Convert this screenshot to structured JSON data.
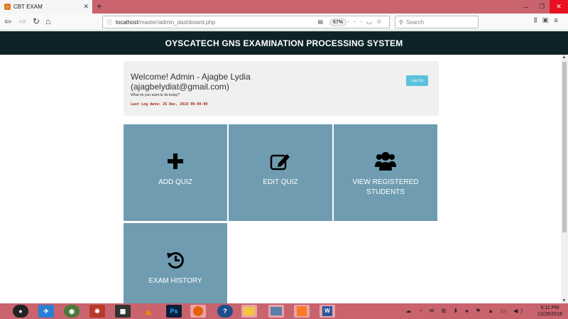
{
  "browser": {
    "tab_title": "CBT EXAM",
    "url_host": "localhost",
    "url_path": "/master/admin_dashboard.php",
    "zoom": "67%",
    "search_placeholder": "Search"
  },
  "header": {
    "title": "OYSCATECH GNS EXAMINATION PROCESSING SYSTEM"
  },
  "welcome": {
    "greeting": "Welcome! Admin - Ajagbe Lydia (ajagbelydiat@gmail.com)",
    "prompt": "What do you want to do today?",
    "last_log": "Last Log date: 26 Dec, 2018 00-00-00",
    "logout_label": "Log Out"
  },
  "tiles": [
    {
      "label": "ADD QUIZ",
      "icon": "plus-icon"
    },
    {
      "label": "EDIT QUIZ",
      "icon": "edit-icon"
    },
    {
      "label": "VIEW REGISTERED STUDENTS",
      "icon": "users-icon"
    },
    {
      "label": "EXAM HISTORY",
      "icon": "history-icon"
    }
  ],
  "taskbar": {
    "time": "6:11 PM",
    "date": "12/26/2018"
  },
  "colors": {
    "header_bg": "#0d2328",
    "tile_bg": "#6f9cb0",
    "logout_bg": "#5bc0de",
    "titlebar": "#c9636e"
  }
}
